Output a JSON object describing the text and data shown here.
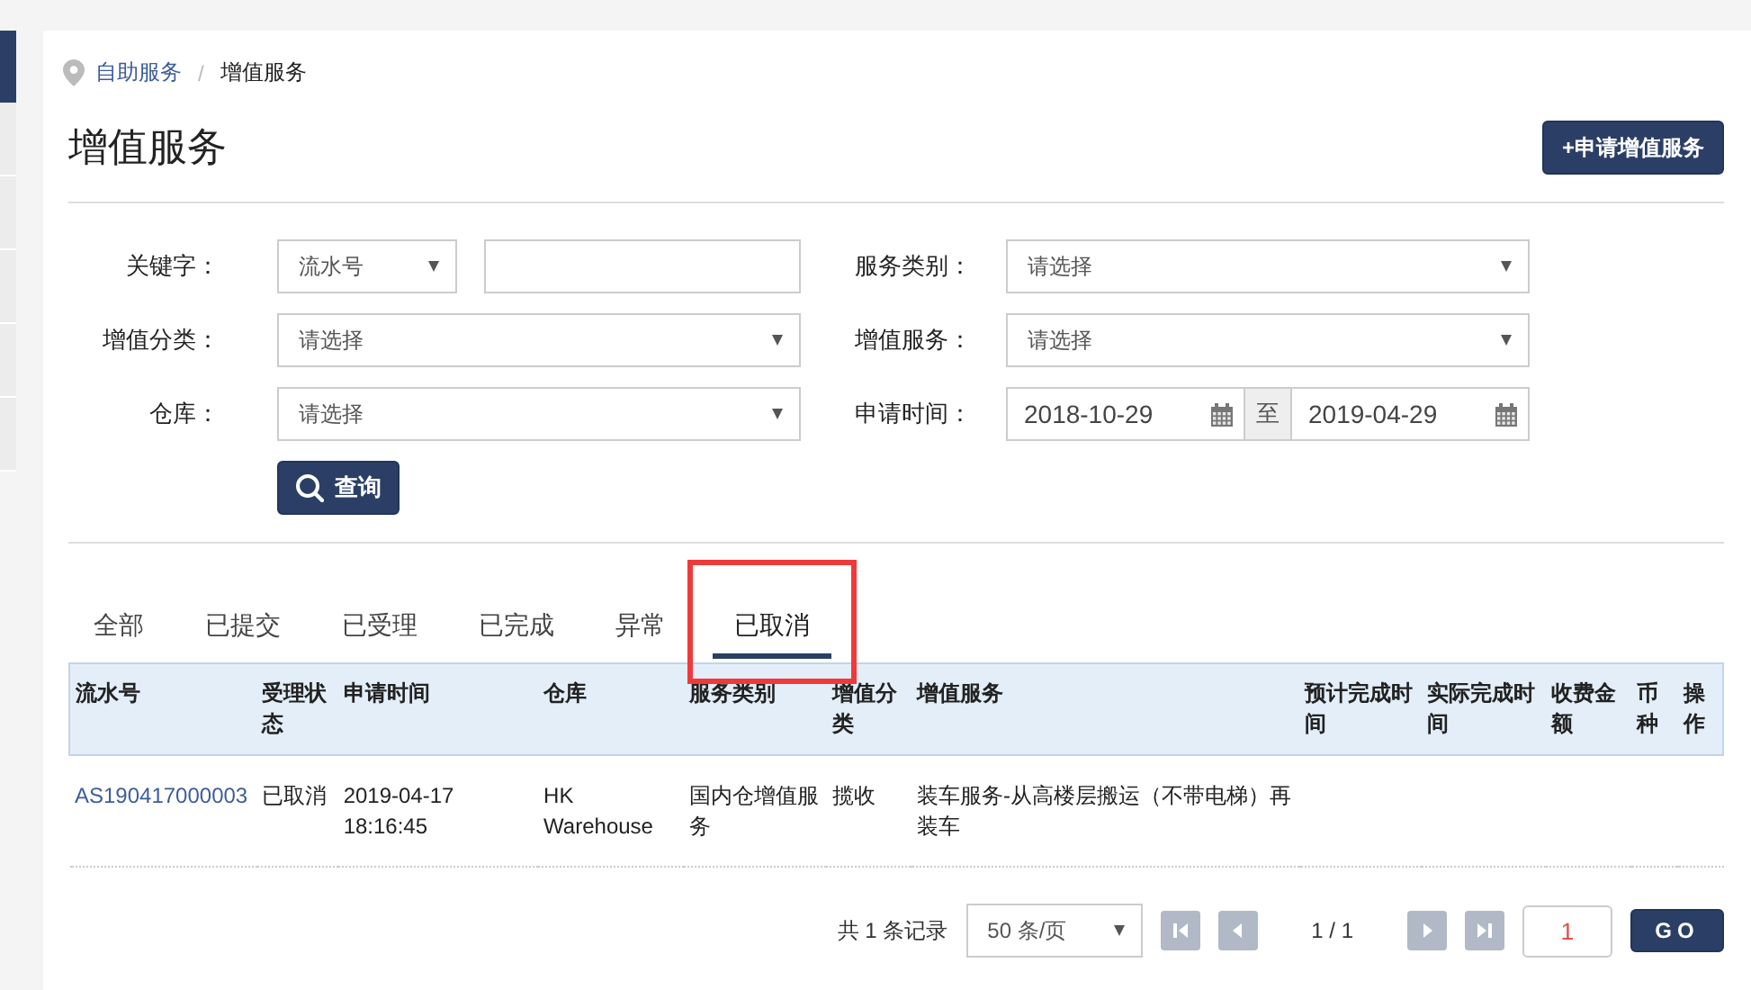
{
  "sidebar": [
    {
      "selected": true
    },
    {
      "selected": false
    },
    {
      "selected": false
    },
    {
      "selected": false
    },
    {
      "selected": false
    },
    {
      "selected": false
    }
  ],
  "breadcrumb_separator": "/",
  "breadcrumb": [
    {
      "label": "自助服务",
      "kind": "link"
    },
    {
      "label": "增值服务",
      "kind": "current"
    }
  ],
  "title": "增值服务",
  "add_button": "+申请增值服务",
  "filters": {
    "left": [
      {
        "label": "关键字：",
        "kind": "keyword",
        "select": "流水号"
      },
      {
        "label": "增值分类：",
        "kind": "select",
        "placeholder": "请选择"
      },
      {
        "label": "仓库：",
        "kind": "select",
        "placeholder": "请选择"
      }
    ],
    "right": [
      {
        "label": "服务类别：",
        "kind": "select",
        "placeholder": "请选择"
      },
      {
        "label": "增值服务：",
        "kind": "select",
        "placeholder": "请选择"
      },
      {
        "label": "申请时间：",
        "kind": "daterange",
        "from": "2018-10-29",
        "separator": "至",
        "to": "2019-04-29"
      }
    ]
  },
  "search_button": "查询",
  "tabs": [
    {
      "label": "全部",
      "selected": false,
      "highlighted": false
    },
    {
      "label": "已提交",
      "selected": false,
      "highlighted": false
    },
    {
      "label": "已受理",
      "selected": false,
      "highlighted": false
    },
    {
      "label": "已完成",
      "selected": false,
      "highlighted": false
    },
    {
      "label": "异常",
      "selected": false,
      "highlighted": false
    },
    {
      "label": "已取消",
      "selected": true,
      "highlighted": true
    }
  ],
  "table": {
    "columns": [
      "流水号",
      "受理状态",
      "申请时间",
      "仓库",
      "服务类别",
      "增值分类",
      "增值服务",
      "预计完成时间",
      "实际完成时间",
      "收费金额",
      "币种",
      "操作"
    ],
    "rows": [
      {
        "cells": [
          "AS190417000003",
          "已取消",
          "2019-04-17 18:16:45",
          "HK Warehouse",
          "国内仓增值服务",
          "揽收",
          "装车服务-从高楼层搬运（不带电梯）再装车"
        ]
      }
    ]
  },
  "pagination": {
    "total": "共 1 条记录",
    "page_size": "50 条/页",
    "page": "1 / 1",
    "page_input": "1",
    "go": "GO",
    "buttons": [
      {
        "kind": "first",
        "disabled": true
      },
      {
        "kind": "prev",
        "disabled": true
      },
      {
        "kind": "next",
        "disabled": true
      },
      {
        "kind": "last",
        "disabled": true
      }
    ]
  }
}
